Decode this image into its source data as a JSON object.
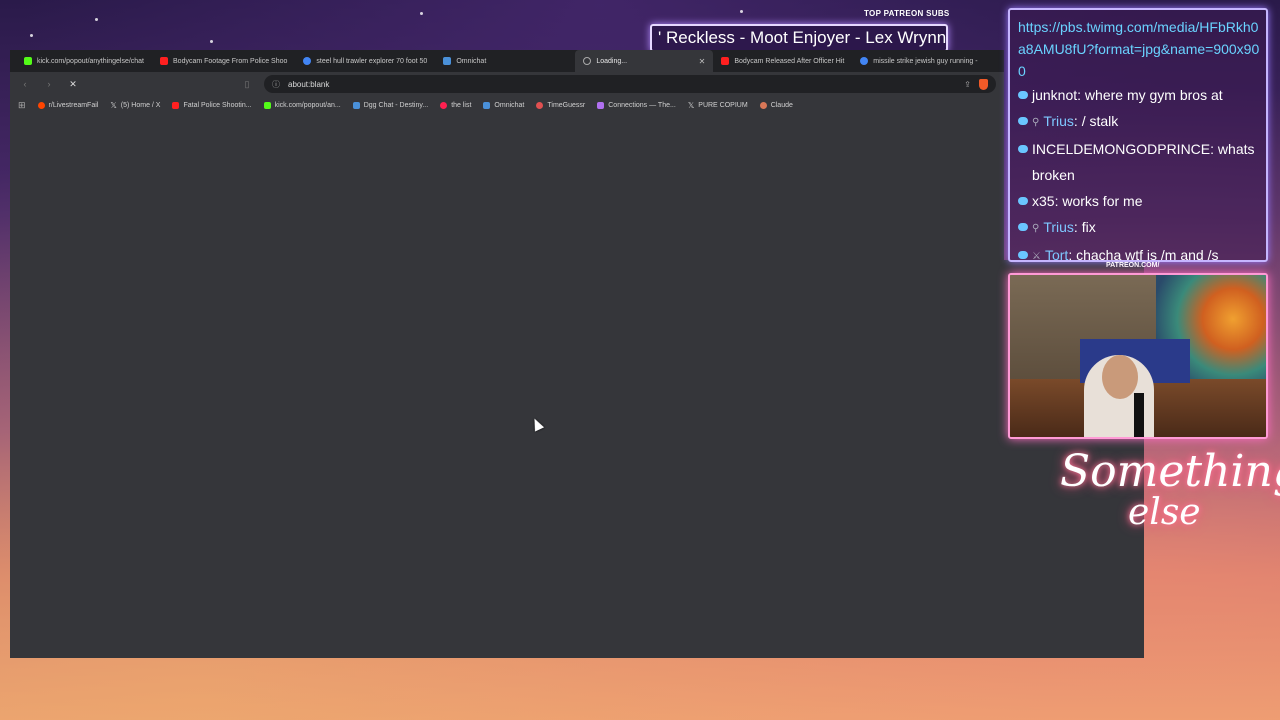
{
  "overlay": {
    "patreon_label": "TOP PATREON SUBS",
    "patreon_names": "' Reckless - Moot Enjoyer - Lex Wrynn",
    "cam_label": "PATREON.COM/",
    "neon_line1": "Something",
    "neon_line2": "else"
  },
  "chat": {
    "url": "https://pbs.twimg.com/media/HFbRkh0a8AMU8fU?format=jpg&name=900x900",
    "messages": [
      {
        "user": "junknot",
        "text": ": where my gym bros at",
        "blue": false
      },
      {
        "user": "Trius",
        "text": ": / stalk",
        "blue": true
      },
      {
        "user": "INCELDEMONGODPRINCE",
        "text": ": whats broken",
        "blue": false
      },
      {
        "user": "x35",
        "text": ": works for me",
        "blue": false
      },
      {
        "user": "Trius",
        "text": ": fix",
        "blue": true
      },
      {
        "user": "Tort",
        "text": ": chacha wtf is /m and /s",
        "blue": true
      }
    ]
  },
  "browser": {
    "tabs": [
      {
        "label": "kick.com/popout/anythingelse/chat",
        "color": "#53fc18"
      },
      {
        "label": "Bodycam Footage From Police Shoo",
        "color": "#ff2020"
      },
      {
        "label": "steel hull trawler explorer 70 foot 50",
        "color": "#4285f4"
      },
      {
        "label": "Omnichat",
        "color": "#4a90d9"
      },
      {
        "label": "Loading...",
        "color": "#888888",
        "active": true
      },
      {
        "label": "Bodycam Released After Officer Hit",
        "color": "#ff2020"
      },
      {
        "label": "missile strike jewish guy running -",
        "color": "#4285f4"
      }
    ],
    "address": "about:blank",
    "bookmarks": [
      {
        "label": "r/LivestreamFail",
        "color": "#ff4500"
      },
      {
        "label": "(5) Home / X",
        "color": "#ffffff"
      },
      {
        "label": "Fatal Police Shootin...",
        "color": "#ff2020"
      },
      {
        "label": "kick.com/popout/an...",
        "color": "#53fc18"
      },
      {
        "label": "Dgg Chat - Destiny...",
        "color": "#4a90d9"
      },
      {
        "label": "the list",
        "color": "#ff2050"
      },
      {
        "label": "Omnichat",
        "color": "#4a90d9"
      },
      {
        "label": "TimeGuessr",
        "color": "#e05050"
      },
      {
        "label": "Connections — The...",
        "color": "#b070f0"
      },
      {
        "label": "PURE COPIUM",
        "color": "#ffffff"
      },
      {
        "label": "Claude",
        "color": "#d97757"
      }
    ]
  }
}
